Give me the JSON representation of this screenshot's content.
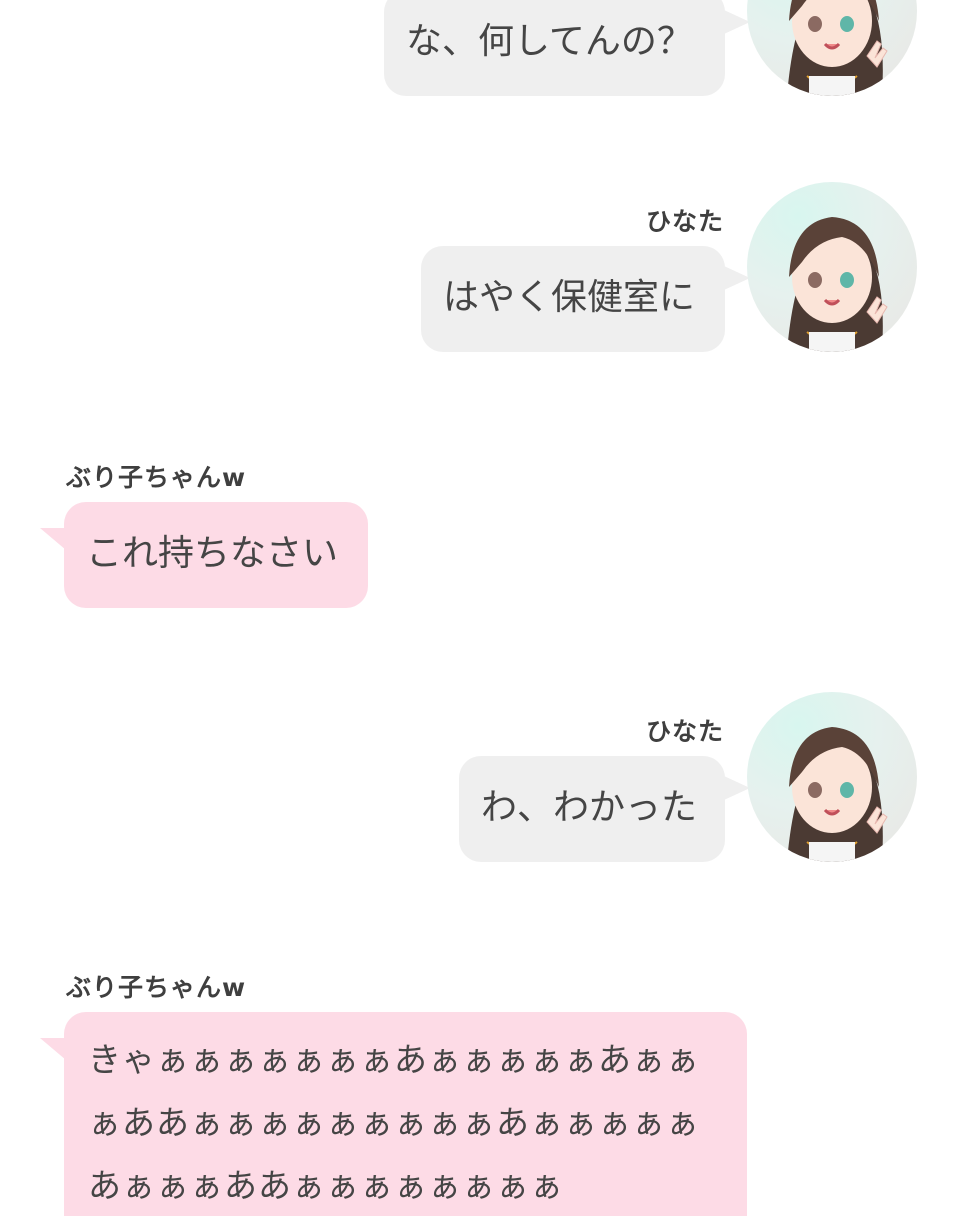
{
  "messages": [
    {
      "side": "right",
      "sender": "",
      "text": "な、何してんの？",
      "color": "#efefef"
    },
    {
      "side": "right",
      "sender": "ひなた",
      "text": "はやく保健室に",
      "color": "#efefef"
    },
    {
      "side": "left",
      "sender": "ぶり子ちゃんw",
      "text": "これ持ちなさい",
      "color": "#fddbe6"
    },
    {
      "side": "right",
      "sender": "ひなた",
      "text": "わ、わかった",
      "color": "#efefef"
    },
    {
      "side": "left",
      "sender": "ぶり子ちゃんw",
      "text": "きゃぁぁぁぁぁぁぁあぁぁぁぁぁあぁぁぁああぁぁぁぁぁぁぁぁぁあぁぁぁぁぁあぁぁぁああぁぁぁぁぁぁぁぁ",
      "color": "#fddbe6"
    }
  ],
  "avatar_icon": "girl-avatar-icon"
}
